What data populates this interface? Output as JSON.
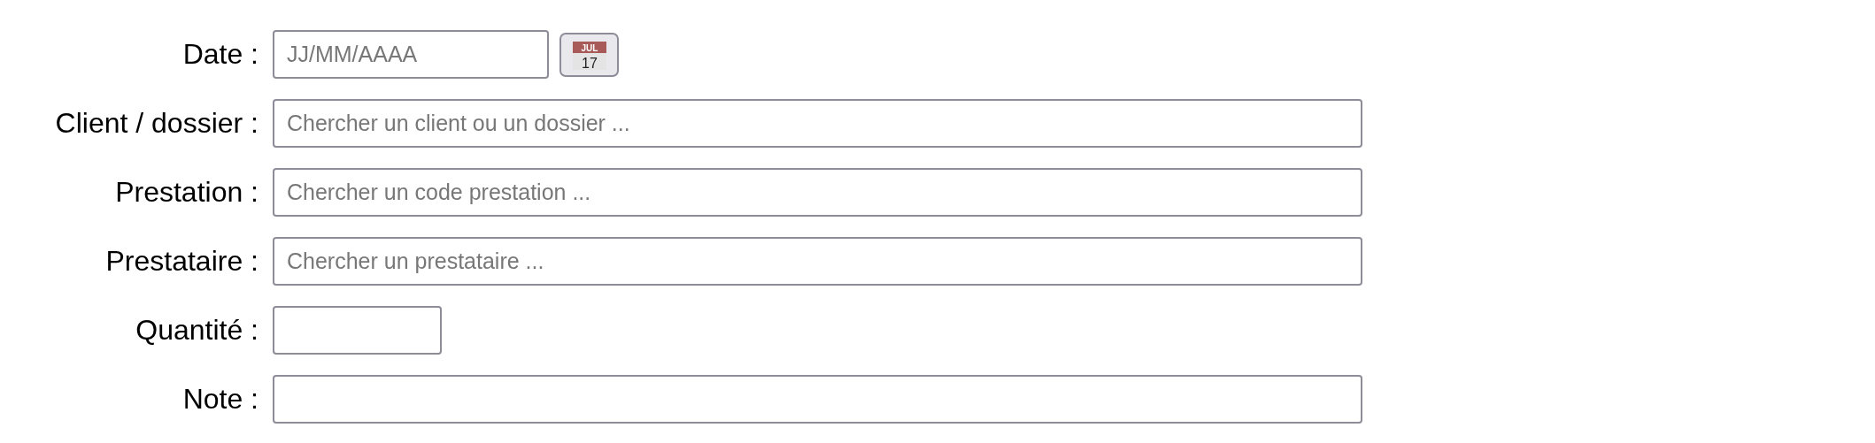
{
  "form": {
    "rows": [
      {
        "kind": "date",
        "label": "Date :",
        "placeholder": "JJ/MM/AAAA",
        "calendar": {
          "month": "JUL",
          "day": "17"
        }
      },
      {
        "kind": "wide",
        "label": "Client / dossier :",
        "placeholder": "Chercher un client ou un dossier ..."
      },
      {
        "kind": "wide",
        "label": "Prestation :",
        "placeholder": "Chercher un code prestation ..."
      },
      {
        "kind": "wide",
        "label": "Prestataire :",
        "placeholder": "Chercher un prestataire ..."
      },
      {
        "kind": "short",
        "label": "Quantité :"
      },
      {
        "kind": "wide",
        "label": "Note :"
      }
    ]
  }
}
